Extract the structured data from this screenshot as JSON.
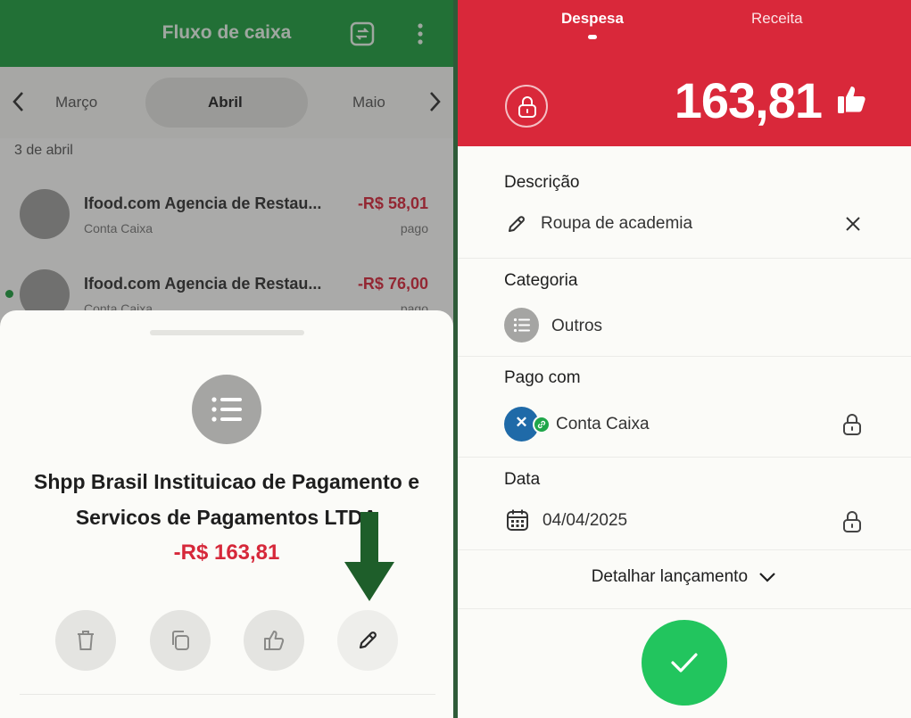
{
  "left": {
    "appbar": {
      "title": "Fluxo de caixa"
    },
    "month_nav": {
      "prev": "Março",
      "current": "Abril",
      "next": "Maio"
    },
    "date_group": "3 de abril",
    "transactions": [
      {
        "name": "Ifood.com Agencia de Restau...",
        "account": "Conta Caixa",
        "amount": "-R$ 58,01",
        "status": "pago"
      },
      {
        "name": "Ifood.com Agencia de Restau...",
        "account": "Conta Caixa",
        "amount": "-R$ 76,00",
        "status": "pago"
      }
    ],
    "sheet": {
      "title_line1": "Shpp Brasil Instituicao de Pagamento e",
      "title_line2": "Servicos de Pagamentos LTDA",
      "amount": "-R$ 163,81"
    },
    "colors": {
      "brand_green": "#1f9d3f",
      "expense_red": "#d6283a",
      "arrow_green": "#1e5e2a"
    }
  },
  "right": {
    "tabs": [
      {
        "label": "Despesa",
        "active": true
      },
      {
        "label": "Receita",
        "active": false
      }
    ],
    "amount": "163,81",
    "fields": {
      "descricao": {
        "label": "Descrição",
        "value": "Roupa de academia"
      },
      "categoria": {
        "label": "Categoria",
        "value": "Outros"
      },
      "pago_com": {
        "label": "Pago com",
        "value": "Conta Caixa"
      },
      "data": {
        "label": "Data",
        "value": "04/04/2025"
      }
    },
    "detail_toggle": "Detalhar lançamento",
    "colors": {
      "header_red": "#d9283a",
      "confirm_green": "#22c55e"
    }
  }
}
